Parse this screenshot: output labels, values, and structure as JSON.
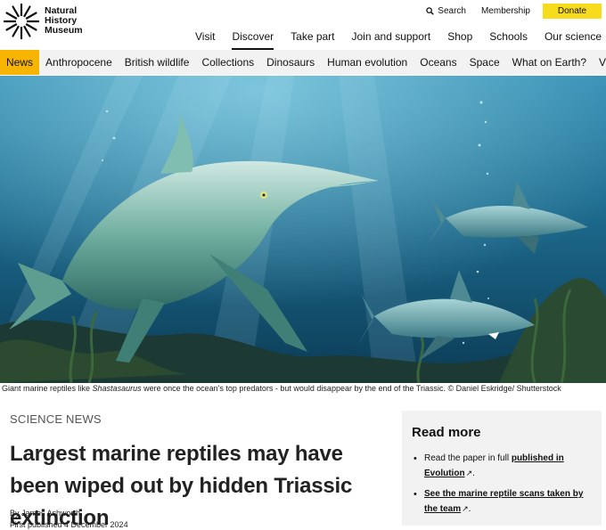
{
  "logo": {
    "line1": "Natural",
    "line2": "History",
    "line3": "Museum"
  },
  "util_nav": {
    "search": "Search",
    "membership": "Membership",
    "donate": "Donate"
  },
  "main_nav": [
    "Visit",
    "Discover",
    "Take part",
    "Join and support",
    "Shop",
    "Schools",
    "Our science"
  ],
  "main_nav_active": "Discover",
  "sub_nav": [
    "News",
    "Anthropocene",
    "British wildlife",
    "Collections",
    "Dinosaurs",
    "Human evolution",
    "Oceans",
    "Space",
    "What on Earth?",
    "Video"
  ],
  "sub_nav_active": "News",
  "colors": {
    "accent_yellow": "#f7dc1e",
    "news_tab": "#f7b400",
    "water_dark": "#0b3b55",
    "water_light": "#4fa6c2"
  },
  "hero": {
    "caption_before": "Giant marine reptiles like ",
    "caption_italic": "Shastasaurus",
    "caption_after": " were once the ocean's top predators - but would disappear by the end of the Triassic. © Daniel Eskridge/ Shutterstock"
  },
  "article": {
    "kicker": "SCIENCE NEWS",
    "title": "Largest marine reptiles may have been wiped out by hidden Triassic extinction",
    "byline": "By James Ashworth",
    "published": "First published 4 December 2024"
  },
  "read_more": {
    "heading": "Read more",
    "item1_prefix": "Read the paper in full ",
    "item1_link": "published in Evolution",
    "item2_link": "See the marine reptile scans taken by the team"
  }
}
